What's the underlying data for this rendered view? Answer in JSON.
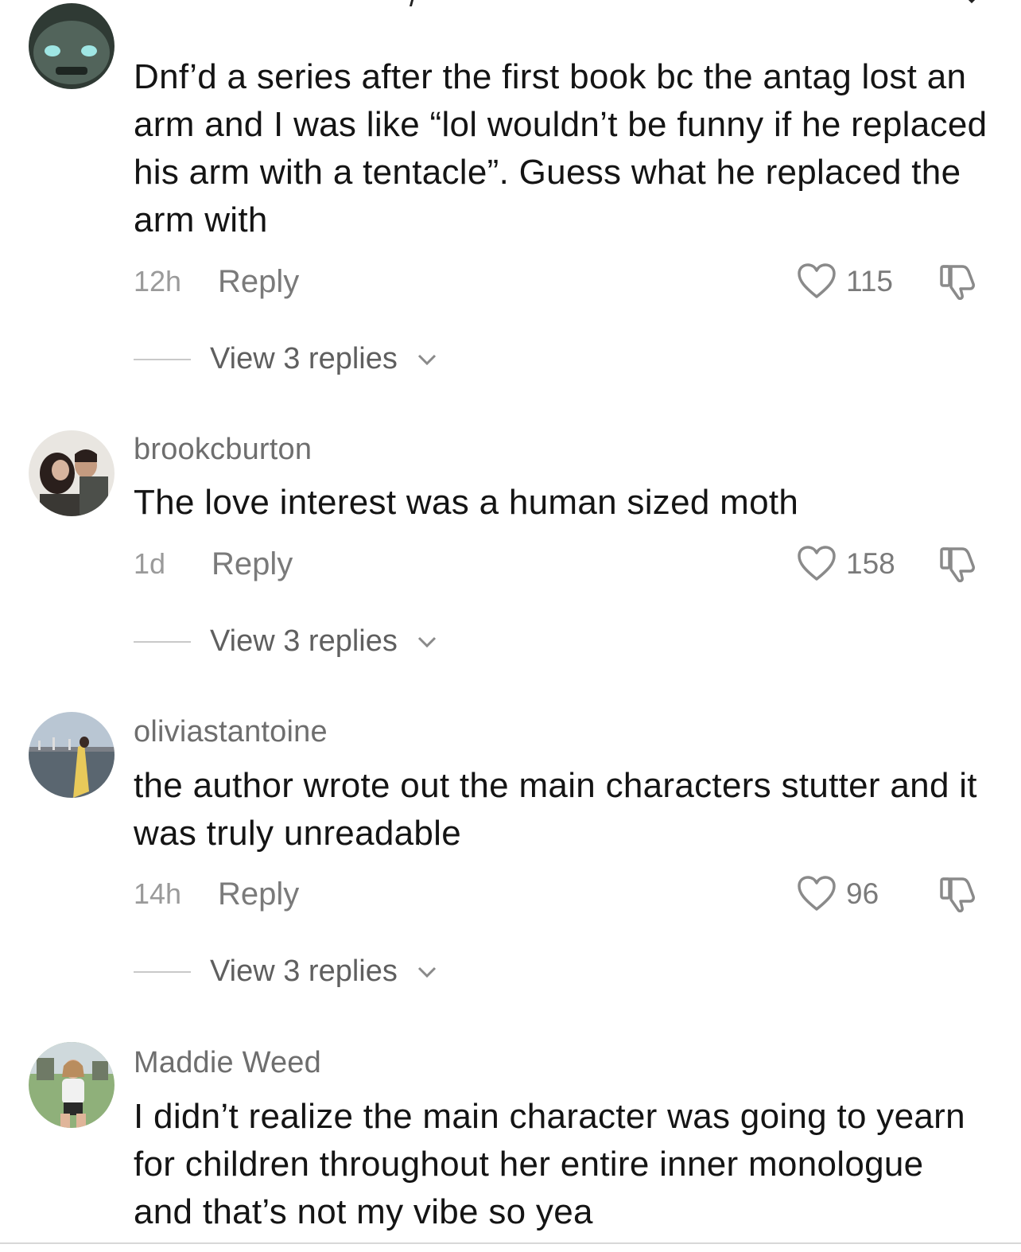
{
  "comments": [
    {
      "username": "",
      "text": "Dnf’d a series after the first book bc the antag lost an arm and I was like “lol wouldn’t be funny if he replaced his arm with a tentacle”. Guess what he replaced the arm with",
      "time": "12h",
      "reply_label": "Reply",
      "likes": "115",
      "view_replies": "View 3 replies"
    },
    {
      "username": "brookcburton",
      "text": "The love interest was a human sized moth",
      "time": "1d",
      "reply_label": "Reply",
      "likes": "158",
      "view_replies": "View 3 replies"
    },
    {
      "username": "oliviastantoine",
      "text": "the author wrote out the main characters stutter and it was truly unreadable",
      "time": "14h",
      "reply_label": "Reply",
      "likes": "96",
      "view_replies": "View 3 replies"
    },
    {
      "username": "Maddie Weed",
      "text": "I didn’t realize the main character was going to yearn for children throughout her entire inner monologue and that’s not my vibe so yea"
    }
  ],
  "icons": {
    "like": "heart-icon",
    "dislike": "thumbs-down-icon",
    "expand": "chevron-down-icon"
  },
  "colors": {
    "text": "#141414",
    "secondary": "#7a7a7a",
    "timestamp": "#9a9a9a"
  }
}
